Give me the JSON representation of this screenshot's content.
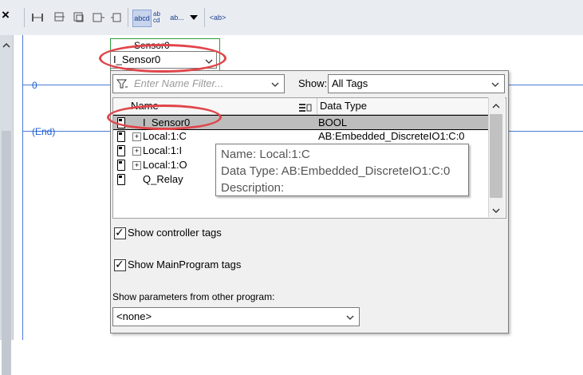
{
  "toolbar": {
    "close": "×",
    "btn_abcd": "abcd",
    "btn_abcd_stack": "ab cd",
    "btn_ab_more": "ab...",
    "btn_ab_tag": "<ab>"
  },
  "ladder": {
    "rung0_number": "0",
    "end_label": "(End)",
    "instruction_tag_above": "Sensor0"
  },
  "operand": {
    "value": "I_Sensor0"
  },
  "panel": {
    "filter_placeholder": "Enter Name Filter...",
    "show_label": "Show:",
    "show_value": "All Tags",
    "columns": {
      "name": "Name",
      "data_type": "Data Type"
    },
    "rows": [
      {
        "name": "I_Sensor0",
        "type": "BOOL",
        "expandable": false,
        "selected": true
      },
      {
        "name": "Local:1:C",
        "type": "AB:Embedded_DiscreteIO1:C:0",
        "expandable": true,
        "selected": false
      },
      {
        "name": "Local:1:I",
        "type": "",
        "expandable": true,
        "selected": false
      },
      {
        "name": "Local:1:O",
        "type": "",
        "expandable": true,
        "selected": false
      },
      {
        "name": "Q_Relay",
        "type": "",
        "expandable": false,
        "selected": false
      }
    ],
    "tooltip": {
      "name": "Name: Local:1:C",
      "data_type": "Data Type: AB:Embedded_DiscreteIO1:C:0",
      "description": "Description:"
    },
    "show_controller_tags": "Show controller tags",
    "show_mainprogram_tags": "Show MainProgram tags",
    "show_params_label": "Show parameters from other program:",
    "program_select_value": "<none>"
  },
  "colors": {
    "annotation_red": "#e0454a",
    "rung_blue": "#4a7ad8",
    "selection_gray": "#bdbdbd"
  }
}
